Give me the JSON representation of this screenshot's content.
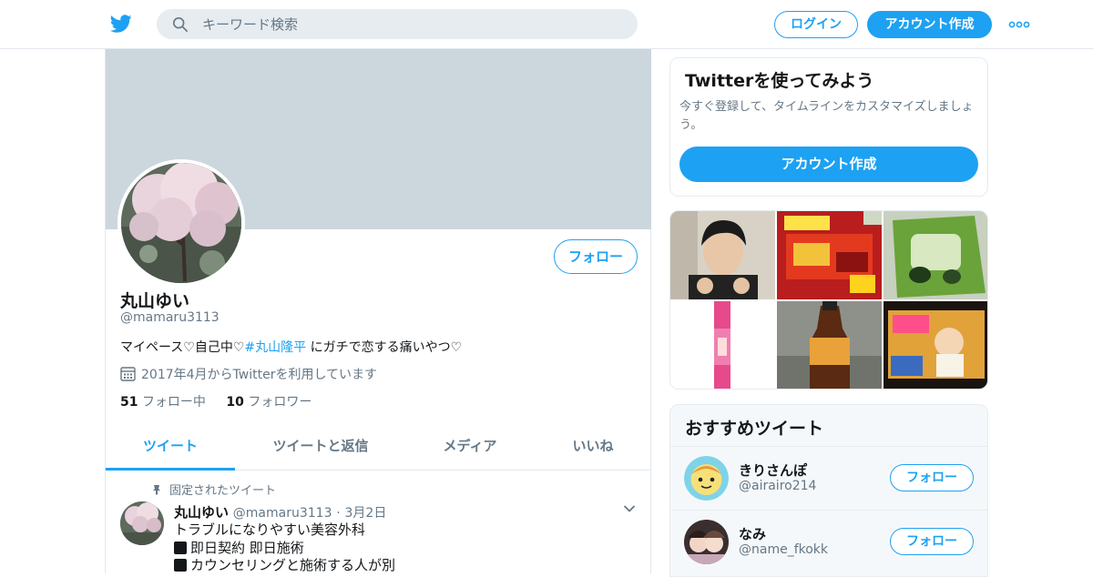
{
  "header": {
    "search_placeholder": "キーワード検索",
    "login_label": "ログイン",
    "signup_label": "アカウント作成",
    "brand_color": "#1da1f2"
  },
  "profile": {
    "name": "丸山ゆい",
    "handle": "@mamaru3113",
    "follow_label": "フォロー",
    "bio_prefix": "マイペース♡自己中♡",
    "bio_hashtag": "#丸山隆平",
    "bio_suffix": " にガチで恋する痛いやつ♡",
    "joined": "2017年4月からTwitterを利用しています",
    "following_count": "51",
    "following_label": "フォロー中",
    "followers_count": "10",
    "followers_label": "フォロワー"
  },
  "tabs": [
    {
      "label": "ツイート",
      "active": true
    },
    {
      "label": "ツイートと返信",
      "active": false
    },
    {
      "label": "メディア",
      "active": false
    },
    {
      "label": "いいね",
      "active": false
    }
  ],
  "pinned_tweet": {
    "pinned_label": "固定されたツイート",
    "author_name": "丸山ゆい",
    "author_handle": "@mamaru3113",
    "separator": "·",
    "date": "3月2日",
    "lines": [
      "トラブルになりやすい美容外科",
      "即日契約 即日施術",
      "カウンセリングと施術する人が別"
    ]
  },
  "signup_card": {
    "title": "Twitterを使ってみよう",
    "text": "今すぐ登録して、タイムラインをカスタマイズしましょう。",
    "button_label": "アカウント作成"
  },
  "recommendations": {
    "title": "おすすめツイート",
    "users": [
      {
        "name": "きりさんぽ",
        "handle": "@airairo214",
        "follow_label": "フォロー"
      },
      {
        "name": "なみ",
        "handle": "@name_fkokk",
        "follow_label": "フォロー"
      }
    ]
  }
}
